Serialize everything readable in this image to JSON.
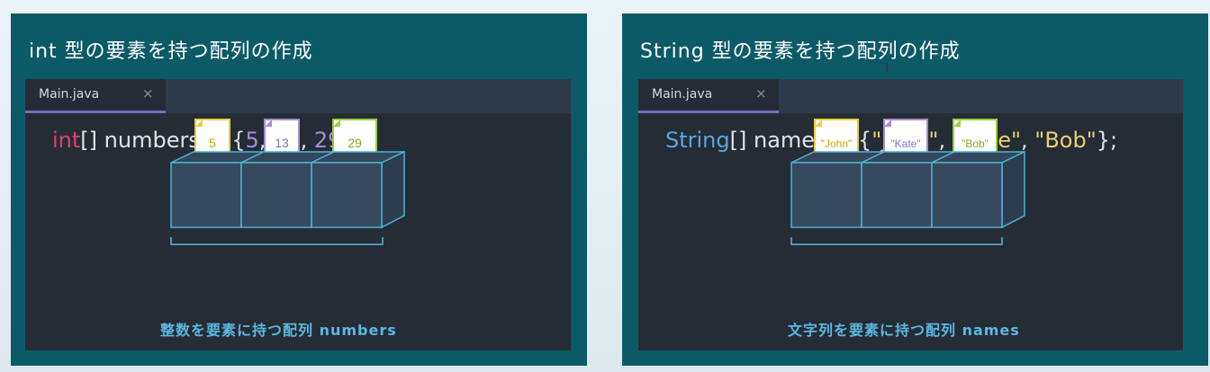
{
  "left_panel": {
    "title": "int 型の要素を持つ配列の作成",
    "tab": {
      "label": "Main.java",
      "close": "×"
    },
    "code": {
      "type": "int",
      "rest": "[] numbers ",
      "eq": "=",
      "open": " {",
      "v1": "5",
      "sep1": ", ",
      "v2": "13",
      "sep2": ", ",
      "v3": "29",
      "close": "};"
    },
    "cards": [
      "5",
      "13",
      "29"
    ],
    "caption": "整数を要素に持つ配列 numbers"
  },
  "right_panel": {
    "title": "String 型の要素を持つ配列の作成",
    "tab": {
      "label": "Main.java",
      "close": "×"
    },
    "code": {
      "type": "String",
      "rest": "[] names ",
      "eq": "=",
      "open": " {",
      "v1": "\"John\"",
      "sep1": ", ",
      "v2": "\"Kate\"",
      "sep2": ", ",
      "v3": "\"Bob\"",
      "close": "};"
    },
    "cards": [
      "\"John\"",
      "\"Kate\"",
      "\"Bob\""
    ],
    "caption": "文字列を要素に持つ配列 names"
  },
  "colors": {
    "panel_bg": "#0c5a68",
    "editor_bg": "#262c35",
    "keyword_int": "#e0406b",
    "keyword_string": "#57a8d8",
    "number": "#a98bd8",
    "string": "#e8cf72",
    "card_yellow": "#e8cf42",
    "card_purple": "#a98bd8",
    "card_green": "#9ccf3e",
    "caption": "#5ab8e0"
  }
}
